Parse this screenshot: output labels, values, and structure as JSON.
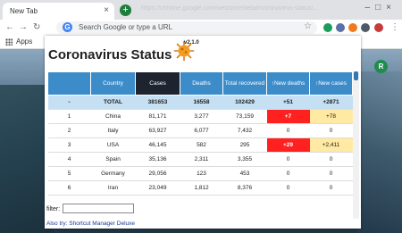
{
  "browser": {
    "tab_title": "New Tab",
    "tab_ghost": "https://chrome.google.com/webstore/detail/coronavirus-status/...",
    "omnibox_placeholder": "Search Google or type a URL",
    "bookmark_apps": "Apps",
    "avatar_letter": "R"
  },
  "popup": {
    "title": "Coronavirus Status",
    "version": "v2.1.0",
    "columns": [
      "",
      "Country",
      "Cases",
      "Deaths",
      "Total recovered",
      "↑New deaths",
      "↑New cases"
    ],
    "total_row": {
      "rank": "-",
      "country": "TOTAL",
      "cases": "381653",
      "deaths": "16558",
      "recovered": "102429",
      "new_deaths": "+51",
      "new_cases": "+2871"
    },
    "rows": [
      {
        "rank": "1",
        "country": "China",
        "cases": "81,171",
        "deaths": "3,277",
        "recovered": "73,159",
        "new_deaths": "+7",
        "new_cases": "+78"
      },
      {
        "rank": "2",
        "country": "Italy",
        "cases": "63,927",
        "deaths": "6,077",
        "recovered": "7,432",
        "new_deaths": "0",
        "new_cases": "0"
      },
      {
        "rank": "3",
        "country": "USA",
        "cases": "46,145",
        "deaths": "582",
        "recovered": "295",
        "new_deaths": "+29",
        "new_cases": "+2,411"
      },
      {
        "rank": "4",
        "country": "Spain",
        "cases": "35,136",
        "deaths": "2,311",
        "recovered": "3,355",
        "new_deaths": "0",
        "new_cases": "0"
      },
      {
        "rank": "5",
        "country": "Germany",
        "cases": "29,056",
        "deaths": "123",
        "recovered": "453",
        "new_deaths": "0",
        "new_cases": "0"
      },
      {
        "rank": "6",
        "country": "Iran",
        "cases": "23,049",
        "deaths": "1,812",
        "recovered": "8,376",
        "new_deaths": "0",
        "new_cases": "0"
      }
    ],
    "filter_label": "filter:",
    "filter_value": "",
    "promo": "Also try: Shortcut Manager Deluxe"
  },
  "colors": {
    "header_blue": "#3d8cca",
    "active_header": "#1d2430",
    "total_row": "#c5dff3",
    "alert_red": "#ff2020",
    "new_cases_yellow": "#ffe9a3"
  }
}
